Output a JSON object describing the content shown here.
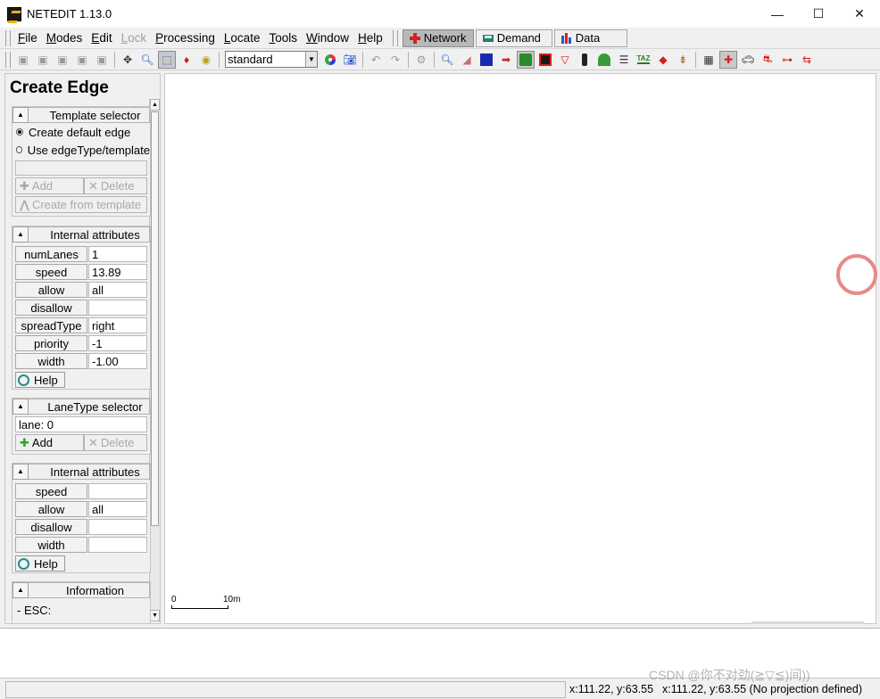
{
  "window": {
    "title": "NETEDIT 1.13.0",
    "minimize": "—",
    "maximize": "☐",
    "close": "✕"
  },
  "menu": {
    "items": [
      {
        "first": "F",
        "rest": "ile",
        "enabled": true
      },
      {
        "first": "M",
        "rest": "odes",
        "enabled": true
      },
      {
        "first": "E",
        "rest": "dit",
        "enabled": true
      },
      {
        "first": "L",
        "rest": "ock",
        "enabled": false
      },
      {
        "first": "P",
        "rest": "rocessing",
        "enabled": true
      },
      {
        "first": "L",
        "rest": "ocate",
        "enabled": true
      },
      {
        "first": "T",
        "rest": "ools",
        "enabled": true
      },
      {
        "first": "W",
        "rest": "indow",
        "enabled": true
      },
      {
        "first": "H",
        "rest": "elp",
        "enabled": true
      }
    ],
    "supermodes": {
      "network": "Network",
      "demand": "Demand",
      "data": "Data"
    }
  },
  "toolbar": {
    "scheme": "standard",
    "taz_label": "TAZ"
  },
  "panel": {
    "title": "Create Edge",
    "template": {
      "label": "Template selector",
      "option_default": "Create default edge",
      "option_type": "Use edgeType/template",
      "add": "Add",
      "delete": "Delete",
      "create_from": "Create from template"
    },
    "edge_attrs": {
      "label": "Internal attributes",
      "rows": [
        {
          "name": "numLanes",
          "value": "1"
        },
        {
          "name": "speed",
          "value": "13.89"
        },
        {
          "name": "allow",
          "value": "all"
        },
        {
          "name": "disallow",
          "value": ""
        },
        {
          "name": "spreadType",
          "value": "right"
        },
        {
          "name": "priority",
          "value": "-1"
        },
        {
          "name": "width",
          "value": "-1.00"
        }
      ],
      "help": "Help"
    },
    "lanetype": {
      "label": "LaneType selector",
      "lane": "lane: 0",
      "add": "Add",
      "delete": "Delete"
    },
    "lane_attrs": {
      "label": "Internal attributes",
      "rows": [
        {
          "name": "speed",
          "value": ""
        },
        {
          "name": "allow",
          "value": "all"
        },
        {
          "name": "disallow",
          "value": ""
        },
        {
          "name": "width",
          "value": ""
        }
      ],
      "help": "Help"
    },
    "information": {
      "label": "Information",
      "line1": "- ESC:"
    }
  },
  "canvas": {
    "scale_zero": "0",
    "scale_ten": "10m"
  },
  "status": {
    "coord1": "x:111.22, y:63.55",
    "coord2": "x:111.22, y:63.55 (No projection defined)"
  },
  "watermark": "CSDN @你不对劲(≧▽≦)间))",
  "colors": {
    "accent_red": "#d81e1e",
    "cursor_circle": "#e88a8a",
    "help_icon": "#2a8a8a"
  }
}
